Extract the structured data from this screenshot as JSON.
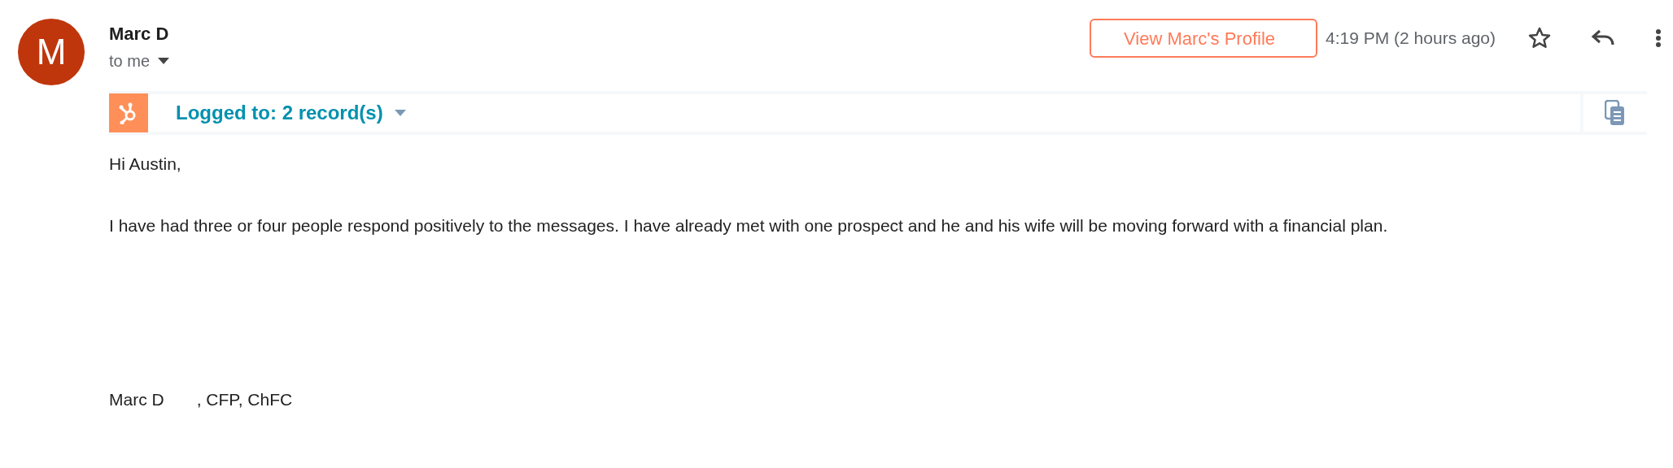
{
  "sender": {
    "initial": "M",
    "name": "Marc D",
    "recipient": "to me"
  },
  "profile_button": "View Marc's Profile",
  "time": "4:19 PM (2 hours ago)",
  "starred": false,
  "logged": {
    "label": "Logged to: 2 record(s)"
  },
  "body": {
    "greeting": "Hi Austin,",
    "paragraph": "I have had three or four people respond positively to the messages. I have already met with one prospect and he and his wife will be moving forward with a financial plan."
  },
  "signature": [
    "Marc D",
    ", CFP, ChFC"
  ]
}
